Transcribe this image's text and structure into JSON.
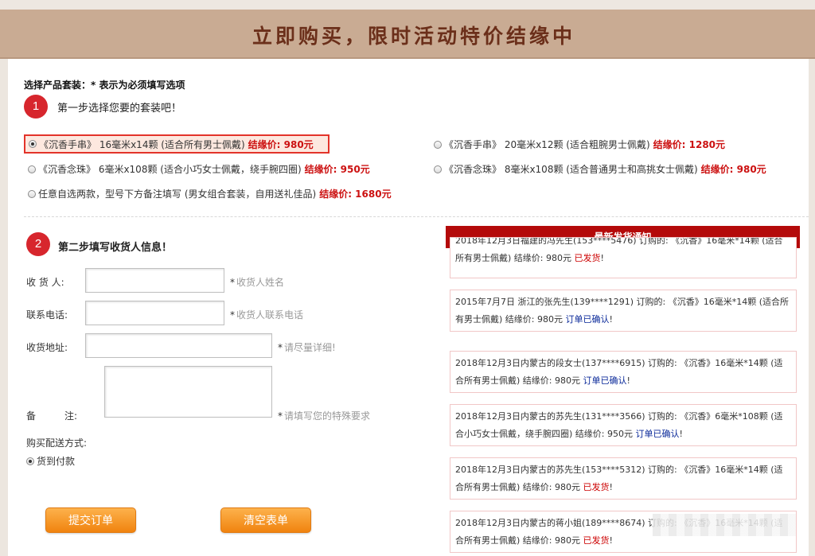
{
  "banner": {
    "title": "立即购买，限时活动特价结缘中"
  },
  "section_hint": "选择产品套装：* 表示为必须填写选项",
  "step1": {
    "number": "1",
    "title": "第一步选择您要的套装吧！"
  },
  "step2": {
    "number": "2",
    "title": "第二步填写收货人信息！"
  },
  "packages": [
    {
      "text": "《沉香手串》 16毫米x14颗 (适合所有男士佩戴)",
      "price": "结缘价: 980元",
      "selected": true
    },
    {
      "text": "《沉香手串》 20毫米x12颗 (适合粗腕男士佩戴)",
      "price": "结缘价: 1280元",
      "selected": false
    },
    {
      "text": "《沉香念珠》 6毫米x108颗 (适合小巧女士佩戴，绕手腕四圈)",
      "price": "结缘价: 950元",
      "selected": false
    },
    {
      "text": "《沉香念珠》 8毫米x108颗 (适合普通男士和高挑女士佩戴)",
      "price": "结缘价: 980元",
      "selected": false
    },
    {
      "text": "任意自选两款，型号下方备注填写 (男女组合套装，自用送礼佳品)",
      "price": "结缘价: 1680元",
      "selected": false
    }
  ],
  "form": {
    "name_label": "收 货 人:",
    "name_hint": "收货人姓名",
    "phone_label": "联系电话:",
    "phone_hint": "收货人联系电话",
    "address_label": "收货地址:",
    "address_hint": "请尽量详细!",
    "notes_label": "备　　　注:",
    "notes_hint": "请填写您的特殊要求",
    "required_mark": "*",
    "delivery_label": "购买配送方式:",
    "delivery_option": "货到付款",
    "submit_label": "提交订单",
    "clear_label": "清空表单"
  },
  "notices": {
    "header": "最新发货通知",
    "items": [
      {
        "text": "2018年12月3日福建的冯先生(153****5476) 订购的: 《沉香》16毫米*14颗 (适合所有男士佩戴) 结缘价: 980元",
        "status": "已发货",
        "status_type": "shipped"
      },
      {
        "text": "2015年7月7日 浙江的张先生(139****1291) 订购的: 《沉香》16毫米*14颗 (适合所有男士佩戴) 结缘价: 980元",
        "status": "订单已确认",
        "status_type": "confirmed"
      },
      {
        "text": "2018年12月3日内蒙古的段女士(137****6915) 订购的: 《沉香》16毫米*14颗 (适合所有男士佩戴) 结缘价: 980元",
        "status": "订单已确认",
        "status_type": "confirmed"
      },
      {
        "text": "2018年12月3日内蒙古的苏先生(131****3566) 订购的: 《沉香》6毫米*108颗 (适合小巧女士佩戴，绕手腕四圈) 结缘价: 950元",
        "status": "订单已确认",
        "status_type": "confirmed"
      },
      {
        "text": "2018年12月3日内蒙古的苏先生(153****5312) 订购的: 《沉香》16毫米*14颗 (适合所有男士佩戴) 结缘价: 980元",
        "status": "已发货",
        "status_type": "shipped"
      },
      {
        "text": "2018年12月3日内蒙古的蒋小姐(189****8674) 订购的: 《沉香》16毫米*14颗 (适合所有男士佩戴) 结缘价: 980元",
        "status": "已发货",
        "status_type": "shipped"
      }
    ]
  },
  "colors": {
    "banner_bg": "#c9ab93",
    "accent_red": "#b40a0a",
    "price_red": "#cc1111",
    "button_orange": "#f0830f"
  }
}
